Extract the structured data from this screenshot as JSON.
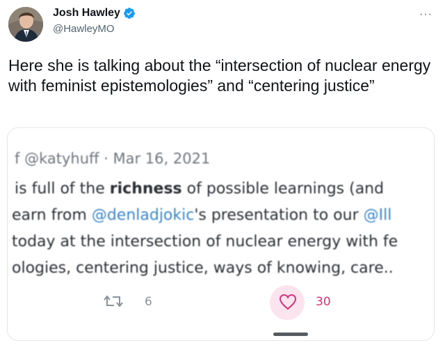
{
  "author": {
    "name": "Josh Hawley",
    "handle": "@HawleyMO",
    "verified": true
  },
  "more_label": "···",
  "tweet_text": "Here she is talking about the “intersection of nuclear energy with feminist epistemologies” and “centering justice”",
  "quoted_screenshot": {
    "meta": "f @katyhuff · Mar 16, 2021",
    "line1_prefix": " is full of the ",
    "line1_bold": "richness",
    "line1_suffix": " of possible learnings (and",
    "line2_prefix": "earn from ",
    "line2_link1": "@denladjokic",
    "line2_middle": "'s presentation to our ",
    "line2_link2": "@Ill",
    "line3": "today at the intersection of nuclear energy with fe",
    "line4": "ologies, centering justice, ways of knowing, care..",
    "retweets": "6",
    "likes": "30"
  },
  "colors": {
    "link": "#3a86c8",
    "like": "#d3337a",
    "verified": "#1d9bf0"
  }
}
